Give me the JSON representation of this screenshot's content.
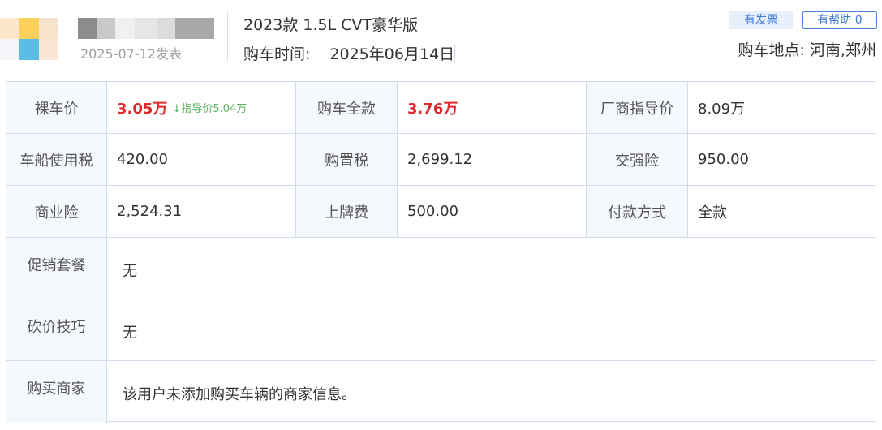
{
  "header": {
    "post_date": "2025-07-12发表",
    "car_model": "2023款 1.5L CVT豪华版",
    "purchase_time_label": "购车时间:",
    "purchase_time_value": "2025年06月14日",
    "invoice_badge": "有发票",
    "helpful_button": "有帮助 0",
    "location": "购车地点: 河南,郑州"
  },
  "details": {
    "bare_price_label": "裸车价",
    "bare_price_value": "3.05万",
    "guide_note": "↓指导价5.04万",
    "full_price_label": "购车全款",
    "full_price_value": "3.76万",
    "msrp_label": "厂商指导价",
    "msrp_value": "8.09万",
    "vessel_tax_label": "车船使用税",
    "vessel_tax_value": "420.00",
    "purchase_tax_label": "购置税",
    "purchase_tax_value": "2,699.12",
    "compulsory_ins_label": "交强险",
    "compulsory_ins_value": "950.00",
    "commercial_ins_label": "商业险",
    "commercial_ins_value": "2,524.31",
    "plate_fee_label": "上牌费",
    "plate_fee_value": "500.00",
    "payment_label": "付款方式",
    "payment_value": "全款",
    "promo_label": "促销套餐",
    "promo_value": "无",
    "bargain_label": "砍价技巧",
    "bargain_value": "无",
    "dealer_label": "购买商家",
    "dealer_value": "该用户未添加购买车辆的商家信息。"
  },
  "colors": {
    "price_red": "#e0292b",
    "guide_green": "#57b35c",
    "accent_blue": "#3f7bd9",
    "label_bg": "#f5f8fd",
    "border": "#cfdcee"
  }
}
